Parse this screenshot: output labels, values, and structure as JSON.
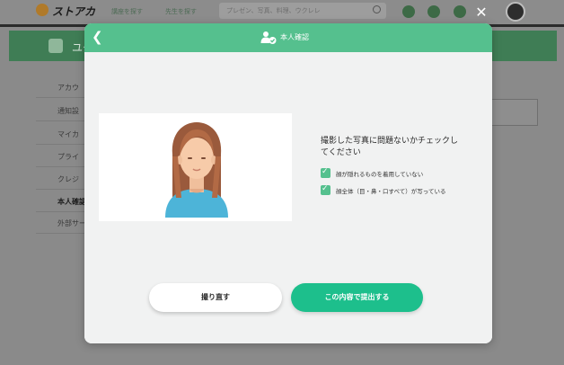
{
  "background": {
    "logo_text": "ストアカ",
    "nav_links": [
      "講座を探す",
      "先生を探す"
    ],
    "search_placeholder": "プレゼン、写真、料理、ウクレレ",
    "banner_title": "ユー",
    "sidebar_items": [
      "アカウ",
      "通知設",
      "マイカ",
      "プライ",
      "クレジ",
      "本人確認",
      "外部サー"
    ],
    "active_sidebar_index": 5
  },
  "modal": {
    "header_title": "本人確認",
    "check_title": "撮影した写真に問題ないかチェックしてください",
    "checks": [
      {
        "label": "顔が隠れるものを着用していない",
        "checked": true
      },
      {
        "label": "顔全体（目・鼻・口すべて）が写っている",
        "checked": true
      }
    ],
    "retake_label": "撮り直す",
    "submit_label": "この内容で提出する"
  },
  "colors": {
    "accent": "#55c08e",
    "submit": "#1dbf8c"
  },
  "icons": {
    "back": "chevron-left-icon",
    "header": "user-check-icon",
    "close": "close-icon"
  }
}
